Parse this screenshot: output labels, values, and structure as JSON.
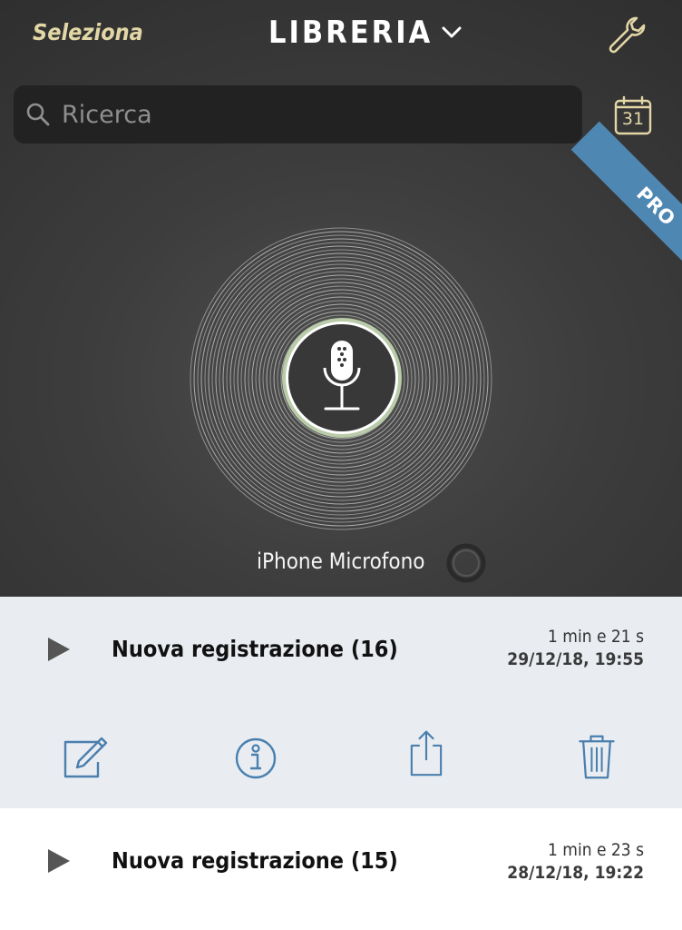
{
  "header": {
    "select_label": "Seleziona",
    "title": "LIBRERIA"
  },
  "search": {
    "placeholder": "Ricerca"
  },
  "calendar": {
    "day": "31"
  },
  "pro_badge": "PRO",
  "recorder": {
    "input_source": "iPhone Microfono"
  },
  "recordings": [
    {
      "title": "Nuova registrazione (16)",
      "duration": "1 min e 21 s",
      "date": "29/12/18, 19:55",
      "selected": true
    },
    {
      "title": "Nuova registrazione (15)",
      "duration": "1 min e 23 s",
      "date": "28/12/18, 19:22",
      "selected": false
    }
  ],
  "actions": [
    "edit-icon",
    "info-icon",
    "share-icon",
    "trash-icon"
  ],
  "colors": {
    "accent_gold": "#e3d7a6",
    "pro_blue": "#4f87b3",
    "action_blue": "#4a7fae",
    "selected_row_bg": "#e9edf1",
    "dark_bg": "#3d3d3d"
  }
}
